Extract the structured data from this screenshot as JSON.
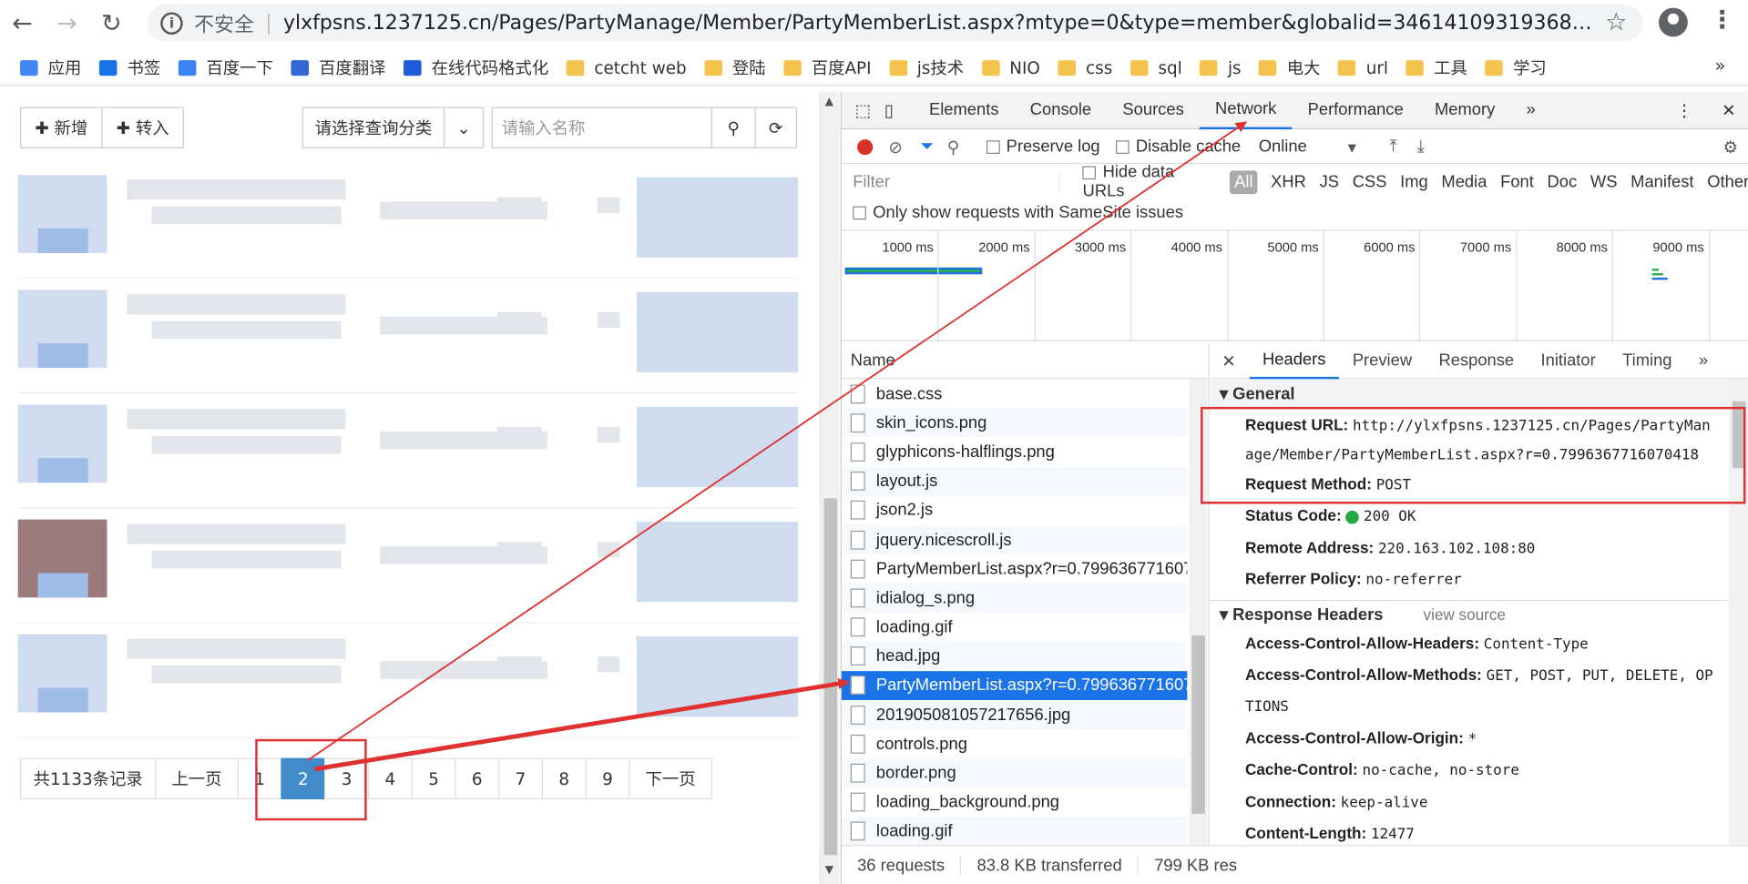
{
  "browser": {
    "unsafe_label": "不安全",
    "url": "ylxfpsns.1237125.cn/Pages/PartyManage/Member/PartyMemberList.aspx?mtype=0&type=member&globalid=3461410931936854016&regio...",
    "bookmarks": [
      "应用",
      "书签",
      "百度一下",
      "百度翻译",
      "在线代码格式化",
      "cetcht web",
      "登陆",
      "百度API",
      "js技术",
      "NIO",
      "css",
      "sql",
      "js",
      "电大",
      "url",
      "工具",
      "学习"
    ],
    "more": "»"
  },
  "page": {
    "add_label": "✚ 新增",
    "import_label": "✚ 转入",
    "category_select": "请选择查询分类",
    "search_placeholder": "请输入名称",
    "pager": {
      "total": "共1133条记录",
      "prev": "上一页",
      "pages": [
        "1",
        "2",
        "3",
        "4",
        "5",
        "6",
        "7",
        "8",
        "9"
      ],
      "active_page": "2",
      "next": "下一页"
    }
  },
  "devtools": {
    "tabs": [
      "Elements",
      "Console",
      "Sources",
      "Network",
      "Performance",
      "Memory",
      "»"
    ],
    "active_tab": "Network",
    "preserve_log": "Preserve log",
    "disable_cache": "Disable cache",
    "throttle": "Online",
    "filter_placeholder": "Filter",
    "hide_data_urls": "Hide data URLs",
    "filter_types": [
      "All",
      "XHR",
      "JS",
      "CSS",
      "Img",
      "Media",
      "Font",
      "Doc",
      "WS",
      "Manifest",
      "Other"
    ],
    "same_site": "Only show requests with SameSite issues",
    "timeline_labels": [
      "1000 ms",
      "2000 ms",
      "3000 ms",
      "4000 ms",
      "5000 ms",
      "6000 ms",
      "7000 ms",
      "8000 ms",
      "9000 ms"
    ],
    "name_header": "Name",
    "requests": [
      "base.css",
      "skin_icons.png",
      "glyphicons-halflings.png",
      "layout.js",
      "json2.js",
      "jquery.nicescroll.js",
      "PartyMemberList.aspx?r=0.7996367716070...",
      "idialog_s.png",
      "loading.gif",
      "head.jpg",
      "PartyMemberList.aspx?r=0.7996367716070...",
      "201905081057217656.jpg",
      "controls.png",
      "border.png",
      "loading_background.png",
      "loading.gif"
    ],
    "selected_request_index": 10,
    "status": {
      "requests": "36 requests",
      "transferred": "83.8 KB transferred",
      "resources": "799 KB res"
    },
    "detail_tabs": [
      "Headers",
      "Preview",
      "Response",
      "Initiator",
      "Timing",
      "»"
    ],
    "general": {
      "title": "General",
      "request_url_key": "Request URL:",
      "request_url": "http://ylxfpsns.1237125.cn/Pages/PartyManage/Member/PartyMemberList.aspx?r=0.7996367716070418",
      "method_key": "Request Method:",
      "method": "POST",
      "status_key": "Status Code:",
      "status": "200 OK",
      "remote_key": "Remote Address:",
      "remote": "220.163.102.108:80",
      "referrer_key": "Referrer Policy:",
      "referrer": "no-referrer"
    },
    "response_headers": {
      "title": "Response Headers",
      "view_source": "view source",
      "items": [
        {
          "k": "Access-Control-Allow-Headers:",
          "v": "Content-Type"
        },
        {
          "k": "Access-Control-Allow-Methods:",
          "v": "GET, POST, PUT, DELETE, OPTIONS"
        },
        {
          "k": "Access-Control-Allow-Origin:",
          "v": "*"
        },
        {
          "k": "Cache-Control:",
          "v": "no-cache, no-store"
        },
        {
          "k": "Connection:",
          "v": "keep-alive"
        },
        {
          "k": "Content-Length:",
          "v": "12477"
        }
      ]
    }
  },
  "colors": {
    "accent": "#1a73e8",
    "annotation": "#e03030",
    "pager_active": "#428bca"
  }
}
